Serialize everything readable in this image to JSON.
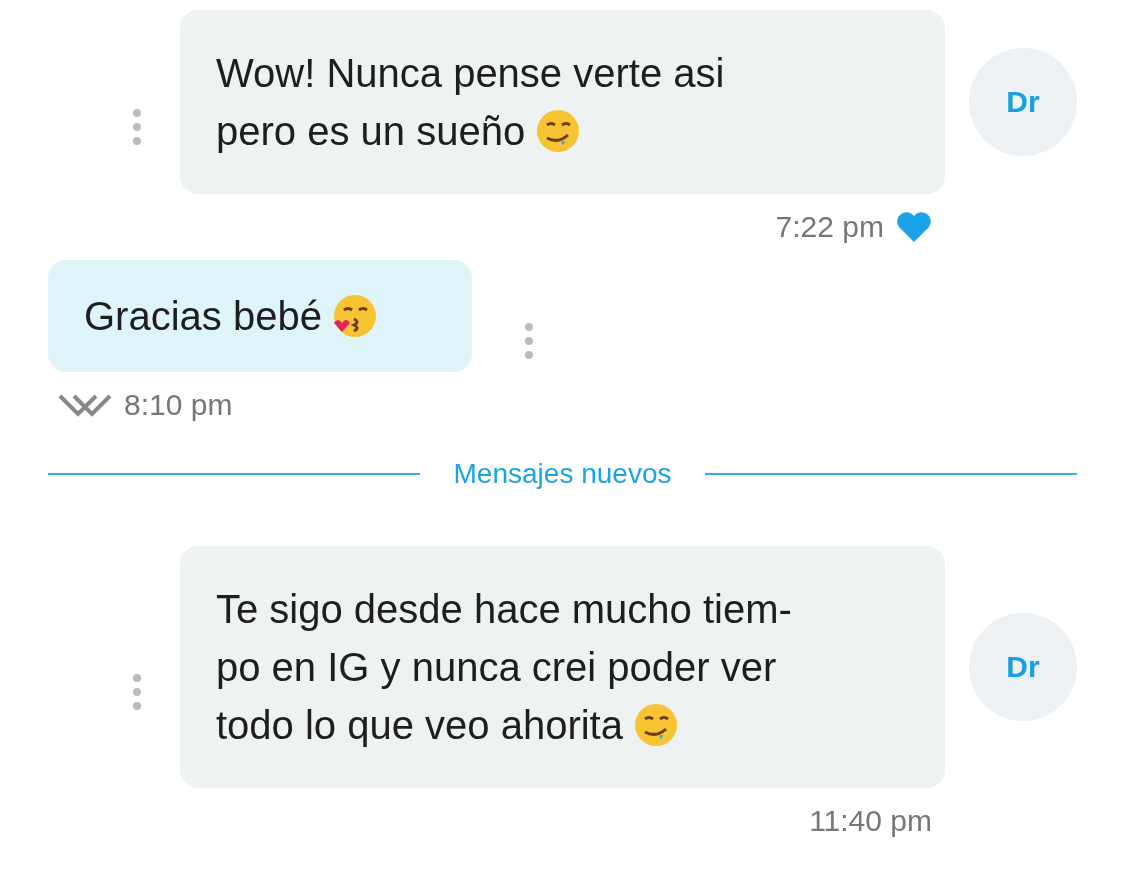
{
  "messages": [
    {
      "kind": "incoming",
      "avatar": "Dr",
      "lines": [
        "Wow! Nunca pense verte asi",
        "pero es un sueño"
      ],
      "emoji": {
        "kind": "drool"
      },
      "time": "7:22 pm",
      "liked": true
    },
    {
      "kind": "outgoing",
      "lines": [
        "Gracias bebé"
      ],
      "emoji": {
        "kind": "kiss"
      },
      "time": "8:10 pm",
      "read": true
    },
    {
      "kind": "divider",
      "text": "Mensajes nuevos"
    },
    {
      "kind": "incoming",
      "avatar": "Dr",
      "lines": [
        "Te sigo desde hace mucho tiem-",
        "po en IG y nunca crei poder ver",
        "todo lo que veo ahorita"
      ],
      "emoji": {
        "kind": "drool"
      },
      "time": "11:40 pm"
    }
  ]
}
